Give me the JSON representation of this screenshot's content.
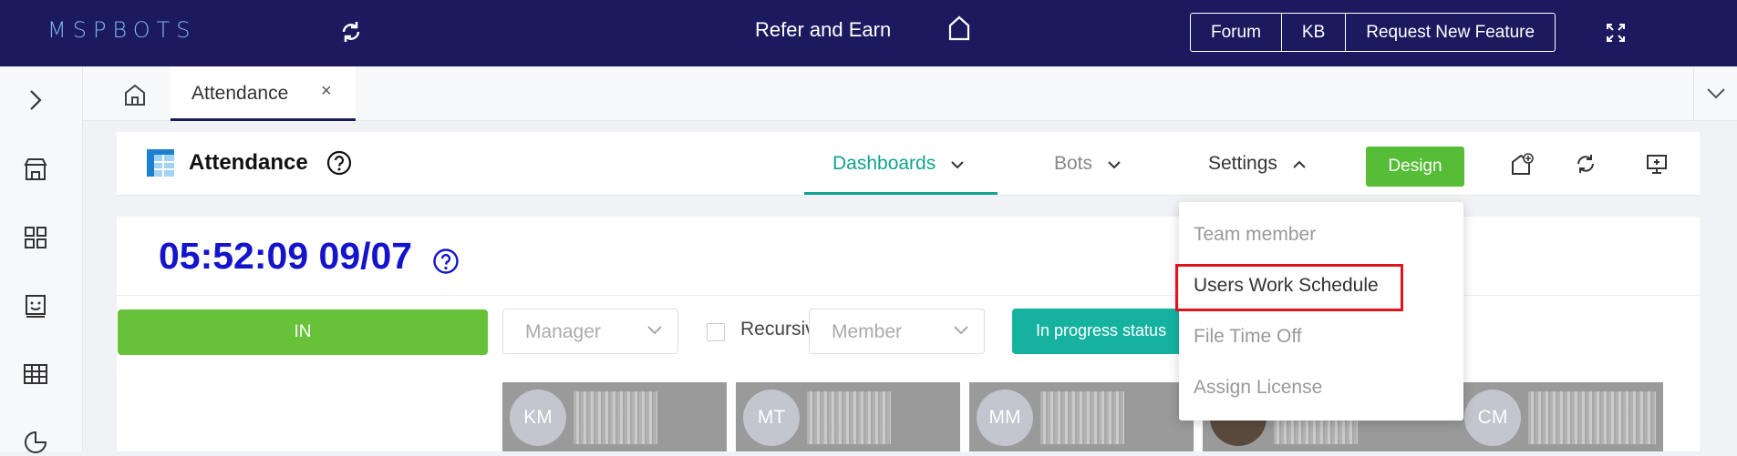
{
  "topbar": {
    "logo": "MSPBOTS",
    "refer": "Refer and Earn",
    "buttons": [
      "Forum",
      "KB",
      "Request New Feature"
    ]
  },
  "tabs": {
    "active_label": "Attendance",
    "close": "×"
  },
  "app": {
    "title": "Attendance",
    "nav": {
      "dashboards": "Dashboards",
      "bots": "Bots",
      "settings": "Settings"
    },
    "design": "Design"
  },
  "panel": {
    "clock": "05:52:09 09/07",
    "in_label": "IN",
    "manager_placeholder": "Manager",
    "recursive_label": "Recursive",
    "member_placeholder": "Member",
    "progress_label": "In progress status"
  },
  "people": [
    {
      "initials": "KM"
    },
    {
      "initials": "MT"
    },
    {
      "initials": "MM"
    },
    {
      "initials": ""
    },
    {
      "initials": "CM"
    }
  ],
  "settings_menu": {
    "items": [
      "Team member",
      "Users Work Schedule",
      "File Time Off",
      "Assign License"
    ],
    "highlighted": "Users Work Schedule"
  },
  "colors": {
    "topbar": "#1c1a5e",
    "accent_teal": "#14a28f",
    "green": "#67c23a",
    "highlight_red": "#e0141e",
    "clock_blue": "#1414cc"
  }
}
